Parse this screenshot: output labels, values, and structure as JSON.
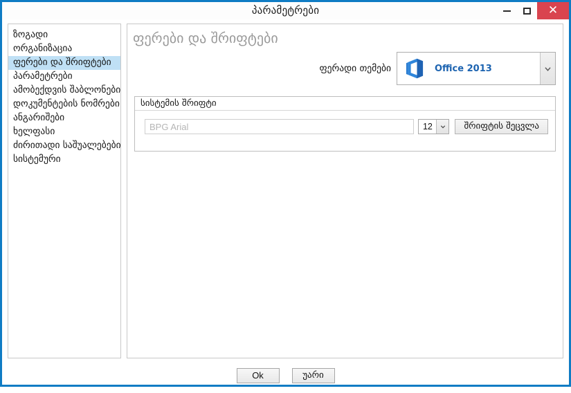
{
  "window": {
    "title": "პარამეტრები",
    "accent_color": "#0f7cc4",
    "controls": {
      "minimize_label": "—",
      "maximize_label": "❑",
      "close_label": "✕",
      "close_color": "#d9444f"
    }
  },
  "sidebar": {
    "items": [
      {
        "label": "ზოგადი",
        "selected": false
      },
      {
        "label": "ორგანიზაცია",
        "selected": false
      },
      {
        "label": "ფერები და შრიფტები",
        "selected": true
      },
      {
        "label": "პარამეტრები",
        "selected": false
      },
      {
        "label": "ამობექდვის შაბლონები",
        "selected": false
      },
      {
        "label": "დოკუმენტების ნომრები",
        "selected": false
      },
      {
        "label": "ანგარიშები",
        "selected": false
      },
      {
        "label": "ხელფასი",
        "selected": false
      },
      {
        "label": "ძირითადი საშუალებები",
        "selected": false
      },
      {
        "label": "სისტემური",
        "selected": false
      }
    ],
    "selected_background": "#bfe0f5"
  },
  "main": {
    "heading": "ფერები და შრიფტები",
    "heading_color": "#9a9a9a",
    "theme": {
      "label": "ფერადი თემები",
      "selected_value": "Office 2013",
      "value_color": "#1c63b0",
      "icon": "office-logo-icon",
      "dropdown_icon": "chevron-down-icon"
    },
    "font_group": {
      "title": "სისტემის შრიფტი",
      "font_name_value": "BPG Arial",
      "font_name_placeholder": "BPG Arial",
      "size_value": "12",
      "size_dropdown_icon": "chevron-down-icon",
      "change_button_label": "შრიფტის შეცვლა"
    }
  },
  "footer": {
    "ok_label": "Ok",
    "cancel_label": "უარი"
  }
}
